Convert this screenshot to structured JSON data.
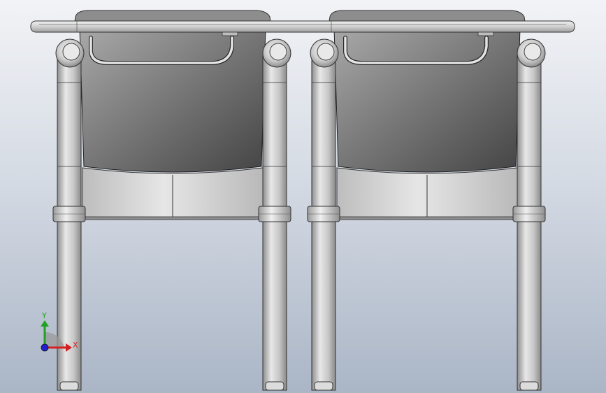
{
  "viewport": {
    "background_top": "#f2f3f6",
    "background_bottom": "#aab5c6"
  },
  "model": {
    "seats": [
      "left-chair",
      "right-chair"
    ],
    "desk_color": "#c8c8c8",
    "leg_color": "#c4c4c4",
    "back_color": "#6e6e6e"
  },
  "triad": {
    "x_label": "X",
    "y_label": "Y",
    "x_color": "#d42020",
    "y_color": "#22a022",
    "z_color": "#2020d0"
  }
}
